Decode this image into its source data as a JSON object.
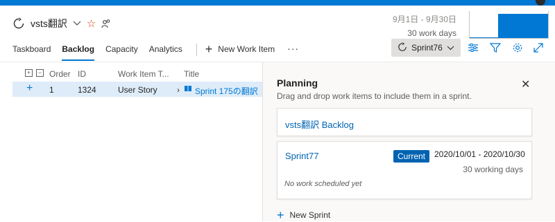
{
  "colors": {
    "accent": "#0078d4",
    "link": "#0063b1",
    "selection": "#deecf9",
    "star": "#d83b01"
  },
  "header": {
    "team_name": "vsts翻訳",
    "icons": [
      "sprint-icon",
      "chevron-down-icon",
      "star-icon",
      "people-icon"
    ],
    "date_range": "9月1日 - 9月30日",
    "work_days": "30 work days"
  },
  "tabs": [
    {
      "label": "Taskboard",
      "active": false
    },
    {
      "label": "Backlog",
      "active": true
    },
    {
      "label": "Capacity",
      "active": false
    },
    {
      "label": "Analytics",
      "active": false
    }
  ],
  "toolbar": {
    "new_work_item": "New Work Item",
    "more": "···",
    "sprint_selector": "Sprint76",
    "tool_icons": [
      "settings-sliders-icon",
      "filter-icon",
      "gear-icon",
      "expand-icon"
    ]
  },
  "grid": {
    "columns": [
      "Order",
      "ID",
      "Work Item T...",
      "Title"
    ],
    "rows": [
      {
        "add": "+",
        "order": "1",
        "id": "1324",
        "type": "User Story",
        "title": "Sprint 175の翻訳"
      }
    ]
  },
  "planning": {
    "title": "Planning",
    "subtitle": "Drag and drop work items to include them in a sprint.",
    "backlog_card": "vsts翻訳 Backlog",
    "sprint": {
      "name": "Sprint77",
      "badge": "Current",
      "range": "2020/10/01 - 2020/10/30",
      "working_days": "30 working days",
      "empty_note": "No work scheduled yet"
    },
    "new_sprint": "New Sprint"
  }
}
